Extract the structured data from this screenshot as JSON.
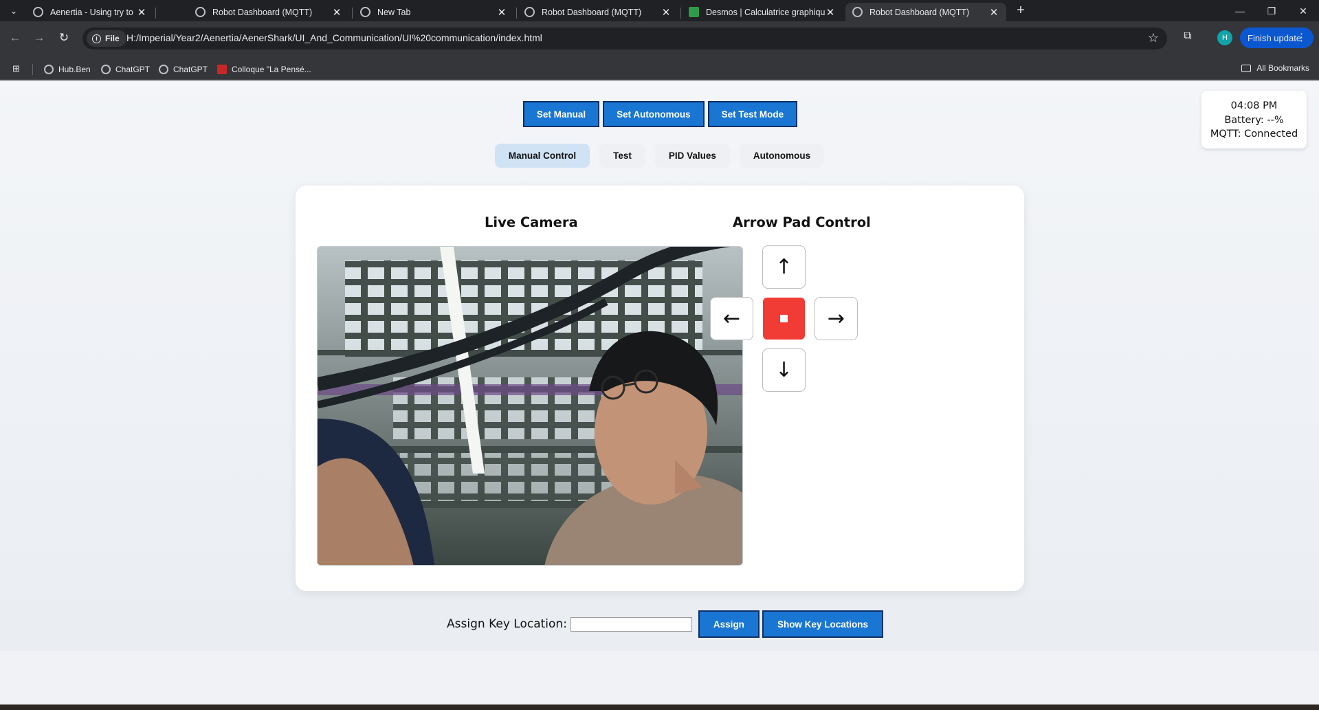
{
  "browser": {
    "tabs": [
      {
        "title": "Aenertia - Using try to handle e",
        "active": false
      },
      {
        "title": "Robot Dashboard (MQTT)",
        "active": false
      },
      {
        "title": "New Tab",
        "active": false
      },
      {
        "title": "Robot Dashboard (MQTT)",
        "active": false
      },
      {
        "title": "Desmos | Calculatrice graphique",
        "active": false
      },
      {
        "title": "Robot Dashboard (MQTT)",
        "active": true
      }
    ],
    "site_chip": "File",
    "url": "H:/Imperial/Year2/Aenertia/AenerShark/UI_And_Communication/UI%20communication/index.html",
    "profile_initial": "H",
    "finish_update": "Finish update",
    "bookmarks": [
      "Hub.Ben",
      "ChatGPT",
      "ChatGPT",
      "Colloque \"La Pensé..."
    ],
    "all_bookmarks": "All Bookmarks"
  },
  "modes": {
    "manual": "Set Manual",
    "autonomous": "Set Autonomous",
    "test": "Set Test Mode"
  },
  "tabs": {
    "manual_control": "Manual Control",
    "test": "Test",
    "pid_values": "PID Values",
    "autonomous": "Autonomous"
  },
  "status": {
    "time": "04:08 PM",
    "battery": "Battery: --%",
    "mqtt": "MQTT: Connected"
  },
  "camera": {
    "title": "Live Camera"
  },
  "pad": {
    "title": "Arrow Pad Control",
    "up": "↑",
    "down": "↓",
    "left": "←",
    "right": "→"
  },
  "assign": {
    "label": "Assign Key Location:",
    "input_value": "",
    "assign_button": "Assign",
    "show_button": "Show Key Locations"
  },
  "colors": {
    "primary_button": "#1976d2",
    "stop_button": "#f03c35",
    "active_tab": "#cfe3f5"
  }
}
